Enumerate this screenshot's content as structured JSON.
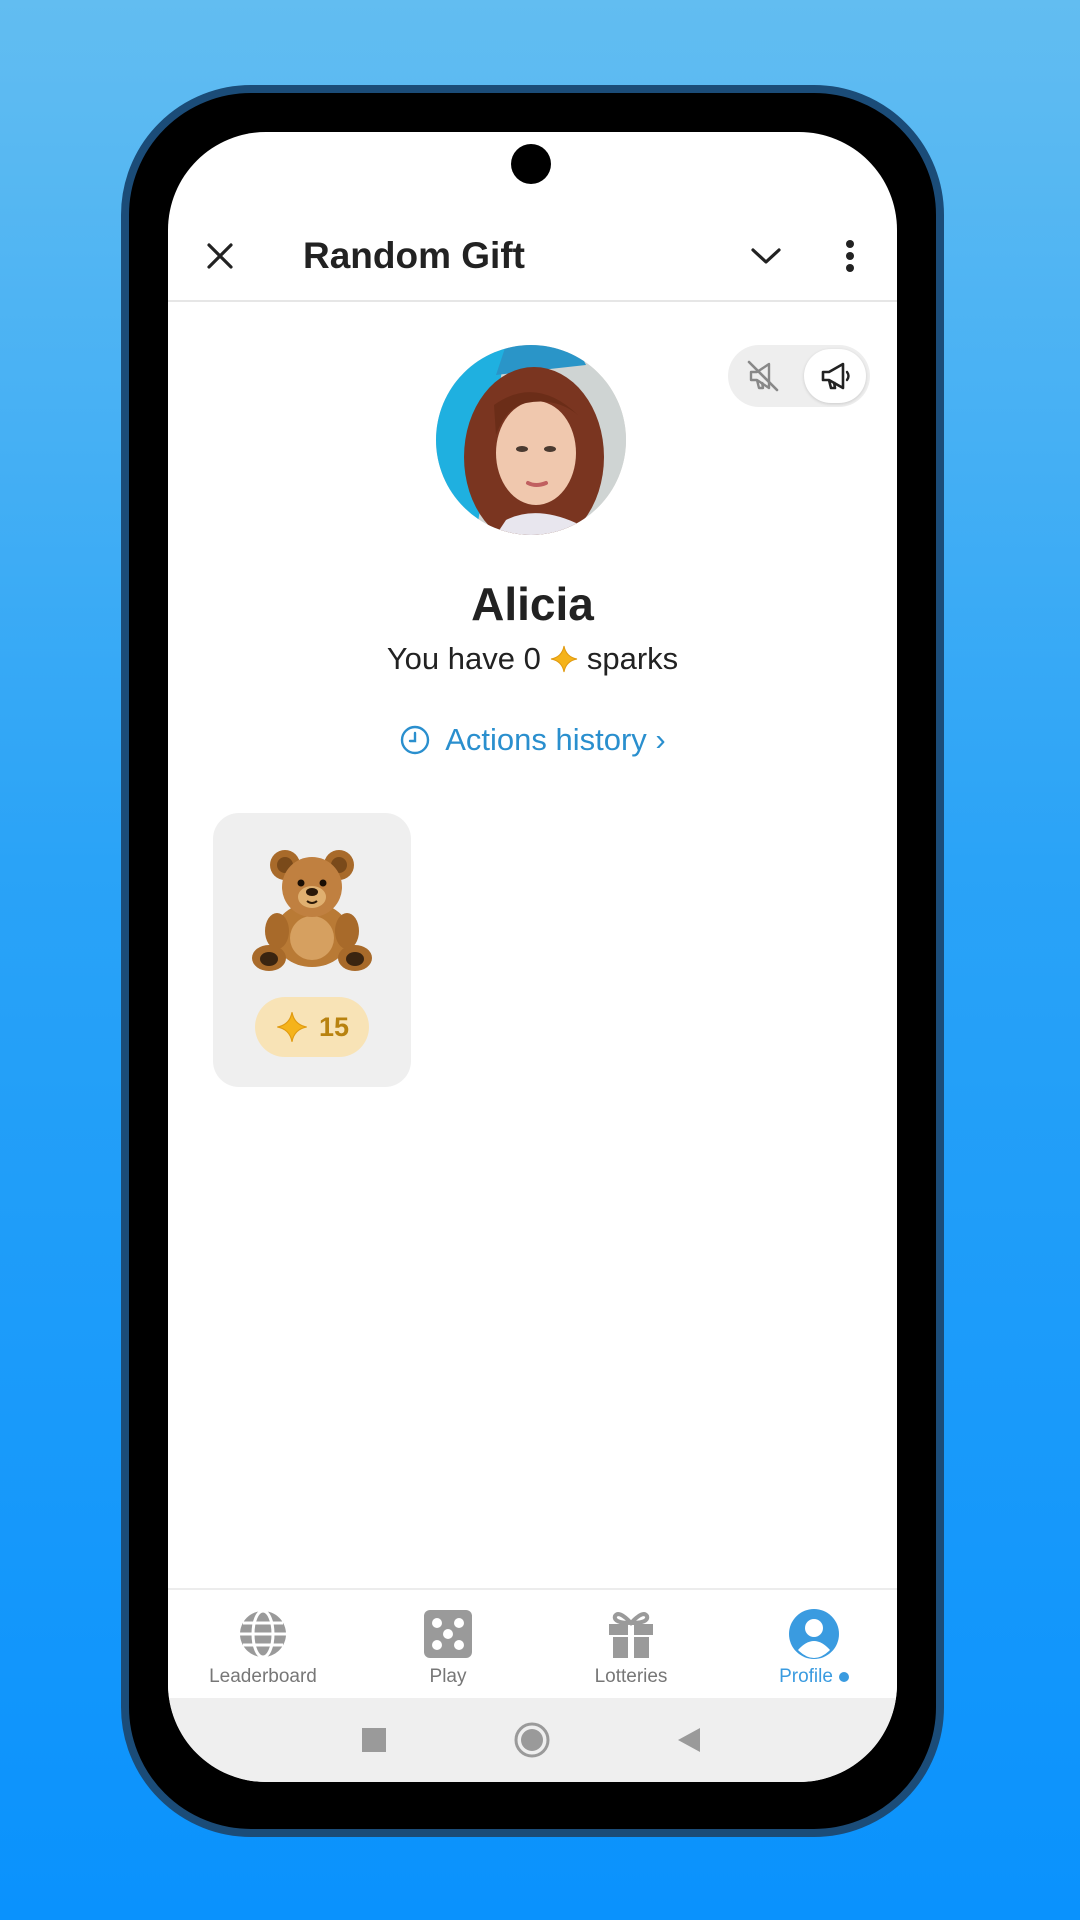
{
  "header": {
    "title": "Random Gift",
    "icons": [
      "close-icon",
      "chevron-down-icon",
      "more-vertical-icon"
    ]
  },
  "sound_toggle": {
    "options": [
      "sound-off-icon",
      "sound-on-icon"
    ],
    "selected": "sound-on"
  },
  "profile": {
    "name": "Alicia",
    "sparks_prefix": "You have 0",
    "sparks_suffix": "sparks",
    "sparks_count": 0
  },
  "actions_history": {
    "label": "Actions history ›",
    "icon": "clock-icon"
  },
  "gifts": [
    {
      "emoji": "🧸",
      "name": "teddy-bear",
      "price": "15"
    }
  ],
  "bottom_nav": {
    "items": [
      {
        "label": "Leaderboard",
        "icon": "globe-icon"
      },
      {
        "label": "Play",
        "icon": "dice-icon"
      },
      {
        "label": "Lotteries",
        "icon": "gift-icon"
      },
      {
        "label": "Profile",
        "icon": "profile-icon",
        "active": true
      }
    ]
  },
  "colors": {
    "accent": "#3a9be0",
    "link": "#2a8fce",
    "spark": "#f5b31a",
    "price_bg": "#f8e3b6",
    "background_top": "#62bdf1",
    "background_bottom": "#0a92fd"
  }
}
